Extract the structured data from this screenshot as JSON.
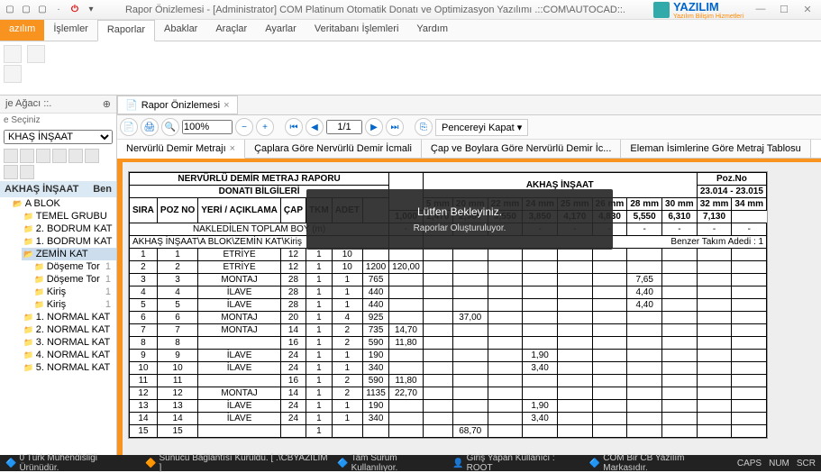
{
  "window": {
    "title": "Rapor Önizlemesi - [Administrator] COM Platinum Otomatik Donatı ve Optimizasyon Yazılımı .::COM\\AUTOCAD::.",
    "logo_main": "YAZILIM",
    "logo_sub": "Yazılım Bilişim Hizmetleri"
  },
  "ribbon": {
    "tabs": [
      "azılım",
      "İşlemler",
      "Raporlar",
      "Abaklar",
      "Araçlar",
      "Ayarlar",
      "Veritabanı İşlemleri",
      "Yardım"
    ],
    "active_index": 2
  },
  "leftpanel": {
    "header": "je Ağacı ::.",
    "select_label": "e Seçiniz",
    "select_value": "KHAŞ İNŞAAT",
    "tree_header": "AKHAŞ İNŞAAT",
    "tree_header_btn": "Ben",
    "tree": [
      {
        "label": "A BLOK",
        "open": true,
        "children": [
          {
            "label": "TEMEL GRUBU"
          },
          {
            "label": "2. BODRUM KAT"
          },
          {
            "label": "1. BODRUM KAT"
          },
          {
            "label": "ZEMİN KAT",
            "open": true,
            "sel": true,
            "children": [
              {
                "label": "Döşeme Tor",
                "cnt": "1"
              },
              {
                "label": "Döşeme Tor",
                "cnt": "1"
              },
              {
                "label": "Kiriş",
                "cnt": "1"
              },
              {
                "label": "Kiriş",
                "cnt": "1"
              }
            ]
          },
          {
            "label": "1. NORMAL KAT"
          },
          {
            "label": "2. NORMAL KAT"
          },
          {
            "label": "3. NORMAL KAT"
          },
          {
            "label": "4. NORMAL KAT"
          },
          {
            "label": "5. NORMAL KAT"
          }
        ]
      }
    ]
  },
  "doctab": {
    "label": "Rapor Önizlemesi"
  },
  "viewer": {
    "zoom": "100%",
    "page": "1/1",
    "close_label": "Pencereyi Kapat"
  },
  "subtabs": [
    {
      "label": "Nervürlü Demir Metrajı",
      "active": true,
      "closable": true
    },
    {
      "label": "Çaplara Göre Nervürlü Demir İcmali"
    },
    {
      "label": "Çap ve Boylara Göre Nervürlü Demir İc..."
    },
    {
      "label": "Eleman İsimlerine Göre Metraj Tablosu"
    }
  ],
  "report": {
    "title_left": "NERVÜRLÜ DEMİR METRAJ RAPORU",
    "title_bilgi": "DONATI BİLGİLERİ",
    "title_right": "AKHAŞ İNŞAAT",
    "pozno_label": "Poz.No",
    "pozno_val": "23.014 - 23.015",
    "headers_left": [
      "SIRA",
      "POZ NO",
      "YERİ / AÇIKLAMA",
      "ÇAP",
      "TKM",
      "ADET"
    ],
    "dia_cols": [
      {
        "d": "5 mm",
        "v": "1,000"
      },
      {
        "d": "20 mm",
        "v": "2,470"
      },
      {
        "d": "22 mm",
        "v": "2,980"
      },
      {
        "d": "24 mm",
        "v": "3,550"
      },
      {
        "d": "25 mm",
        "v": "3,850"
      },
      {
        "d": "26 mm",
        "v": "4,170"
      },
      {
        "d": "28 mm",
        "v": "4,830"
      },
      {
        "d": "30 mm",
        "v": "5,550"
      },
      {
        "d": "32 mm",
        "v": "6,310"
      },
      {
        "d": "34 mm",
        "v": "7,130"
      }
    ],
    "naklrow": "NAKLEDİLEN TOPLAM BOY (m)",
    "grouprow": "AKHAŞ İNŞAAT\\A BLOK\\ZEMİN KAT\\Kiriş",
    "benzer": "Benzer Takım Adedi : 1",
    "rows": [
      {
        "s": "1",
        "p": "1",
        "a": "ETRİYE",
        "c": "12",
        "t": "1",
        "ad": "10",
        "l": "",
        "vals": {}
      },
      {
        "s": "2",
        "p": "2",
        "a": "ETRİYE",
        "c": "12",
        "t": "1",
        "ad": "10",
        "l": "1200",
        "vals": {
          "c0": "120,00"
        }
      },
      {
        "s": "3",
        "p": "3",
        "a": "MONTAJ",
        "c": "28",
        "t": "1",
        "ad": "1",
        "l": "765",
        "vals": {
          "28": "7,65"
        }
      },
      {
        "s": "4",
        "p": "4",
        "a": "İLAVE",
        "c": "28",
        "t": "1",
        "ad": "1",
        "l": "440",
        "vals": {
          "28": "4,40"
        }
      },
      {
        "s": "5",
        "p": "5",
        "a": "İLAVE",
        "c": "28",
        "t": "1",
        "ad": "1",
        "l": "440",
        "vals": {
          "28": "4,40"
        }
      },
      {
        "s": "6",
        "p": "6",
        "a": "MONTAJ",
        "c": "20",
        "t": "1",
        "ad": "4",
        "l": "925",
        "vals": {
          "20": "37,00"
        }
      },
      {
        "s": "7",
        "p": "7",
        "a": "MONTAJ",
        "c": "14",
        "t": "1",
        "ad": "2",
        "l": "735",
        "vals": {
          "c1": "14,70"
        }
      },
      {
        "s": "8",
        "p": "8",
        "a": "",
        "c": "16",
        "t": "1",
        "ad": "2",
        "l": "590",
        "vals": {
          "c2": "11,80"
        }
      },
      {
        "s": "9",
        "p": "9",
        "a": "İLAVE",
        "c": "24",
        "t": "1",
        "ad": "1",
        "l": "190",
        "vals": {
          "24": "1,90"
        }
      },
      {
        "s": "10",
        "p": "10",
        "a": "İLAVE",
        "c": "24",
        "t": "1",
        "ad": "1",
        "l": "340",
        "vals": {
          "24": "3,40"
        }
      },
      {
        "s": "11",
        "p": "11",
        "a": "",
        "c": "16",
        "t": "1",
        "ad": "2",
        "l": "590",
        "vals": {
          "c2": "11,80"
        }
      },
      {
        "s": "12",
        "p": "12",
        "a": "MONTAJ",
        "c": "14",
        "t": "1",
        "ad": "2",
        "l": "1135",
        "vals": {
          "c1": "22,70"
        }
      },
      {
        "s": "13",
        "p": "13",
        "a": "İLAVE",
        "c": "24",
        "t": "1",
        "ad": "1",
        "l": "190",
        "vals": {
          "24": "1,90"
        }
      },
      {
        "s": "14",
        "p": "14",
        "a": "İLAVE",
        "c": "24",
        "t": "1",
        "ad": "1",
        "l": "340",
        "vals": {
          "24": "3,40"
        }
      },
      {
        "s": "15",
        "p": "15",
        "a": "",
        "c": "",
        "t": "1",
        "ad": "",
        "l": "",
        "vals": {
          "20": "68,70"
        }
      }
    ]
  },
  "overlay": {
    "line1": "Lütfen Bekleyiniz.",
    "line2": "Raporlar Oluşturuluyor."
  },
  "status": {
    "s1": "0 Türk Mühendisliği Ürünüdür.",
    "s2": "Sunucu Bağlantısı Kuruldu. [ .\\CBYAZILIM ]",
    "s3": "Tam Sürüm Kullanılıyor.",
    "s4": "Giriş Yapan Kullanıcı : ROOT",
    "s5": "COM Bir CB Yazılım Markasıdır.",
    "caps": "CAPS",
    "num": "NUM",
    "scr": "SCR"
  }
}
